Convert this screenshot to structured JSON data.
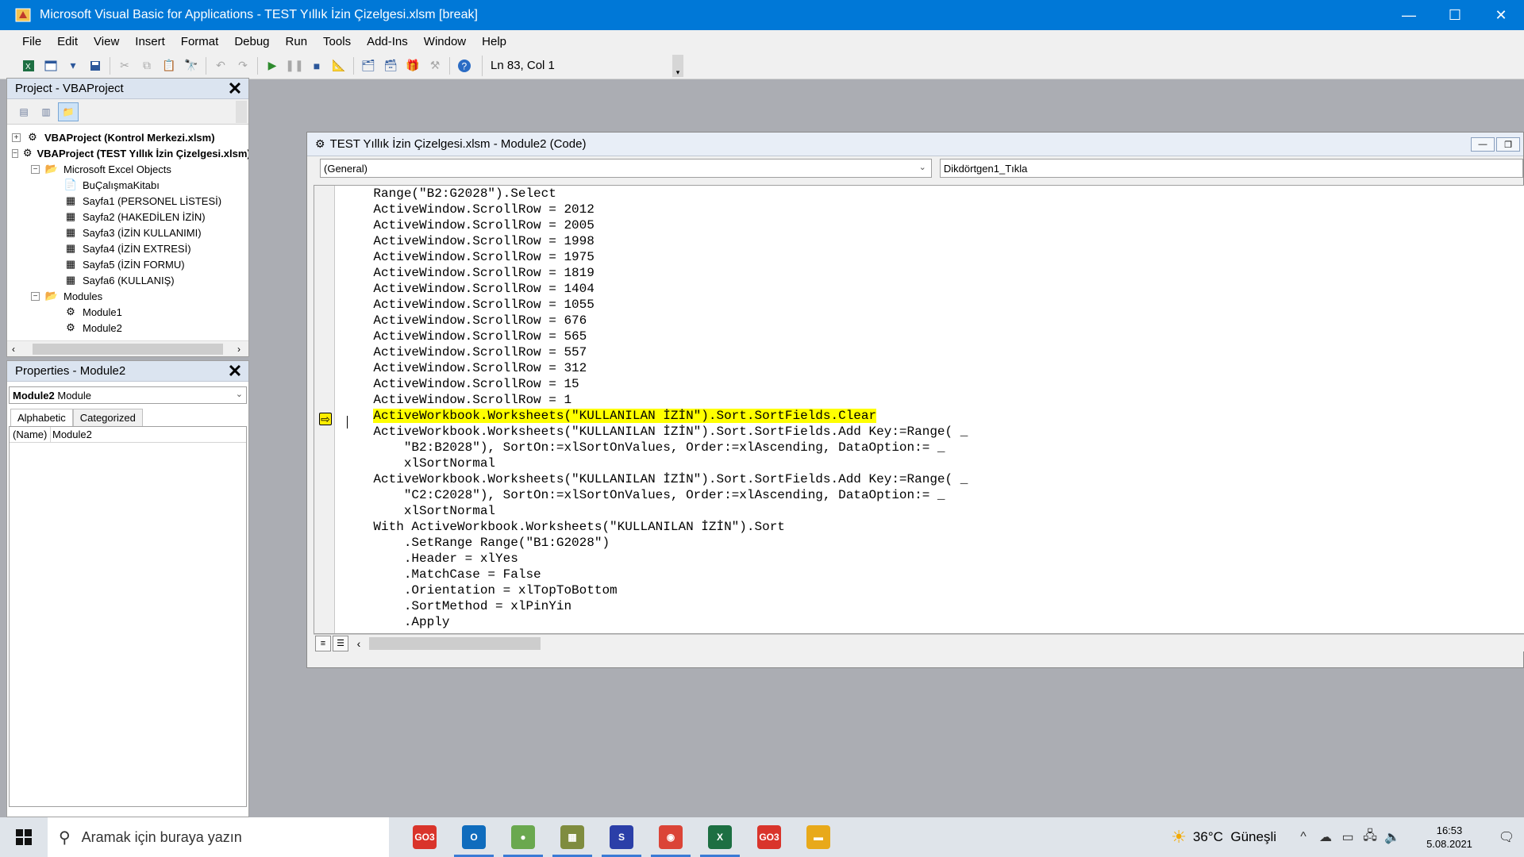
{
  "window": {
    "title": "Microsoft Visual Basic for Applications - TEST Yıllık İzin Çizelgesi.xlsm [break]",
    "minimize": "—",
    "maximize": "☐",
    "close": "✕"
  },
  "menu": {
    "items": [
      {
        "label": "File"
      },
      {
        "label": "Edit"
      },
      {
        "label": "View"
      },
      {
        "label": "Insert"
      },
      {
        "label": "Format"
      },
      {
        "label": "Debug"
      },
      {
        "label": "Run"
      },
      {
        "label": "Tools"
      },
      {
        "label": "Add-Ins"
      },
      {
        "label": "Window"
      },
      {
        "label": "Help"
      }
    ]
  },
  "toolbar": {
    "position": "Ln 83, Col 1"
  },
  "project": {
    "title": "Project - VBAProject",
    "close": "✕",
    "tree": [
      {
        "label": "VBAProject (Kontrol Merkezi.xlsm)",
        "level": 0,
        "exp": "+",
        "bold": true,
        "icon": "vba-project-icon"
      },
      {
        "label": "VBAProject (TEST Yıllık İzin Çizelgesi.xlsm)",
        "level": 0,
        "exp": "−",
        "bold": true,
        "icon": "vba-project-icon"
      },
      {
        "label": "Microsoft Excel Objects",
        "level": 1,
        "exp": "−",
        "bold": false,
        "icon": "folder-icon"
      },
      {
        "label": "BuÇalışmaKitabı",
        "level": 2,
        "exp": "",
        "bold": false,
        "icon": "workbook-icon"
      },
      {
        "label": "Sayfa1 (PERSONEL LİSTESİ)",
        "level": 2,
        "exp": "",
        "bold": false,
        "icon": "sheet-icon"
      },
      {
        "label": "Sayfa2 (HAKEDİLEN İZİN)",
        "level": 2,
        "exp": "",
        "bold": false,
        "icon": "sheet-icon"
      },
      {
        "label": "Sayfa3 (İZİN KULLANIMI)",
        "level": 2,
        "exp": "",
        "bold": false,
        "icon": "sheet-icon"
      },
      {
        "label": "Sayfa4 (İZİN EXTRESİ)",
        "level": 2,
        "exp": "",
        "bold": false,
        "icon": "sheet-icon"
      },
      {
        "label": "Sayfa5 (İZİN FORMU)",
        "level": 2,
        "exp": "",
        "bold": false,
        "icon": "sheet-icon"
      },
      {
        "label": "Sayfa6 (KULLANIŞ)",
        "level": 2,
        "exp": "",
        "bold": false,
        "icon": "sheet-icon"
      },
      {
        "label": "Modules",
        "level": 1,
        "exp": "−",
        "bold": false,
        "icon": "folder-icon"
      },
      {
        "label": "Module1",
        "level": 2,
        "exp": "",
        "bold": false,
        "icon": "module-icon"
      },
      {
        "label": "Module2",
        "level": 2,
        "exp": "",
        "bold": false,
        "icon": "module-icon"
      }
    ]
  },
  "properties": {
    "title": "Properties - Module2",
    "close": "✕",
    "object_name": "Module2",
    "object_type": "Module",
    "tabs": [
      "Alphabetic",
      "Categorized"
    ],
    "rows": [
      {
        "name": "(Name)",
        "value": "Module2"
      }
    ]
  },
  "code_window": {
    "title": "TEST Yıllık İzin Çizelgesi.xlsm - Module2 (Code)",
    "object_combo": "(General)",
    "procedure_combo": "Dikdörtgen1_Tıkla",
    "lines": [
      "    Range(\"B2:G2028\").Select",
      "    ActiveWindow.ScrollRow = 2012",
      "    ActiveWindow.ScrollRow = 2005",
      "    ActiveWindow.ScrollRow = 1998",
      "    ActiveWindow.ScrollRow = 1975",
      "    ActiveWindow.ScrollRow = 1819",
      "    ActiveWindow.ScrollRow = 1404",
      "    ActiveWindow.ScrollRow = 1055",
      "    ActiveWindow.ScrollRow = 676",
      "    ActiveWindow.ScrollRow = 565",
      "    ActiveWindow.ScrollRow = 557",
      "    ActiveWindow.ScrollRow = 312",
      "    ActiveWindow.ScrollRow = 15",
      "    ActiveWindow.ScrollRow = 1",
      "    ActiveWorkbook.Worksheets(\"KULLANILAN İZİN\").Sort.SortFields.Clear",
      "    ActiveWorkbook.Worksheets(\"KULLANILAN İZİN\").Sort.SortFields.Add Key:=Range( _",
      "        \"B2:B2028\"), SortOn:=xlSortOnValues, Order:=xlAscending, DataOption:= _",
      "        xlSortNormal",
      "    ActiveWorkbook.Worksheets(\"KULLANILAN İZİN\").Sort.SortFields.Add Key:=Range( _",
      "        \"C2:C2028\"), SortOn:=xlSortOnValues, Order:=xlAscending, DataOption:= _",
      "        xlSortNormal",
      "    With ActiveWorkbook.Worksheets(\"KULLANILAN İZİN\").Sort",
      "        .SetRange Range(\"B1:G2028\")",
      "        .Header = xlYes",
      "        .MatchCase = False",
      "        .Orientation = xlTopToBottom",
      "        .SortMethod = xlPinYin",
      "        .Apply"
    ],
    "highlight_line": 14
  },
  "taskbar": {
    "search_placeholder": "Aramak için buraya yazın",
    "weather_temp": "36°C",
    "weather_text": "Güneşli",
    "time": "16:53",
    "date": "5.08.2021",
    "apps": [
      {
        "label": "GO3",
        "color": "#d9342b"
      },
      {
        "label": "O",
        "color": "#0f6cbd"
      },
      {
        "label": "●",
        "color": "#6aa84f"
      },
      {
        "label": "▦",
        "color": "#7f8c3f"
      },
      {
        "label": "S",
        "color": "#2b3fa8"
      },
      {
        "label": "◉",
        "color": "#db4437"
      },
      {
        "label": "X",
        "color": "#1d6f42"
      },
      {
        "label": "GO3",
        "color": "#d9342b"
      },
      {
        "label": "▬",
        "color": "#e8a91a"
      }
    ]
  },
  "colors": {
    "titlebar": "#0078d7",
    "highlight": "#ffff00",
    "workspace": "#abadb3"
  }
}
